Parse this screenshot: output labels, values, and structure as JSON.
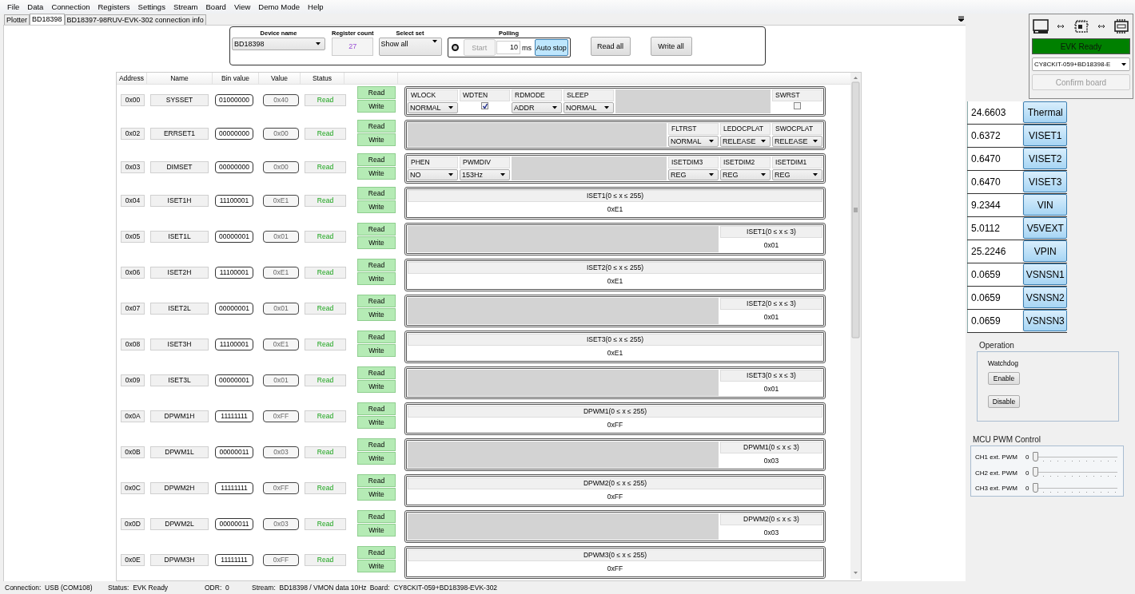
{
  "menu": [
    "File",
    "Data",
    "Connection",
    "Registers",
    "Settings",
    "Stream",
    "Board",
    "View",
    "Demo Mode",
    "Help"
  ],
  "tabs": [
    {
      "label": "Plotter",
      "selected": false
    },
    {
      "label": "BD18398",
      "selected": true
    },
    {
      "label": "BD18397-98RUV-EVK-302 connection info",
      "selected": false
    }
  ],
  "device": {
    "device_name_label": "Device name",
    "device_name": "BD18398",
    "register_count_label": "Register count",
    "register_count": "27",
    "select_set_label": "Select set",
    "select_set": "Show all"
  },
  "polling": {
    "label": "Polling",
    "start": "Start",
    "start_disabled": true,
    "interval": "10",
    "unit": "ms",
    "auto_stop": "Auto stop",
    "auto_stop_on": true
  },
  "read_all": "Read all",
  "write_all": "Write all",
  "register_table": {
    "columns": [
      "Address",
      "Name",
      "Bin value",
      "Value",
      "Status"
    ],
    "rows": [
      {
        "address": "0x00",
        "name": "SYSSET",
        "bin": "01000000",
        "value": "0x40",
        "status": "Read",
        "read": "Read",
        "write": "Write",
        "fields": [
          {
            "kind": "select",
            "label": "WLOCK",
            "value": "NORMAL"
          },
          {
            "kind": "check",
            "label": "WDTEN",
            "checked": true
          },
          {
            "kind": "select",
            "label": "RDMODE",
            "value": "ADDR"
          },
          {
            "kind": "select",
            "label": "SLEEP",
            "value": "NORMAL"
          },
          {
            "kind": "blank"
          },
          {
            "kind": "check",
            "label": "SWRST",
            "checked": false
          }
        ]
      },
      {
        "address": "0x02",
        "name": "ERRSET1",
        "bin": "00000000",
        "value": "0x00",
        "status": "Read",
        "read": "Read",
        "write": "Write",
        "fields": [
          {
            "kind": "blank"
          },
          {
            "kind": "select",
            "label": "FLTRST",
            "value": "NORMAL"
          },
          {
            "kind": "select",
            "label": "LEDOCPLAT",
            "value": "RELEASE"
          },
          {
            "kind": "select",
            "label": "SWOCPLAT",
            "value": "RELEASE"
          }
        ]
      },
      {
        "address": "0x03",
        "name": "DIMSET",
        "bin": "00000000",
        "value": "0x00",
        "status": "Read",
        "read": "Read",
        "write": "Write",
        "fields": [
          {
            "kind": "select",
            "label": "PHEN",
            "value": "NO"
          },
          {
            "kind": "select",
            "label": "PWMDIV",
            "value": "153Hz"
          },
          {
            "kind": "blank"
          },
          {
            "kind": "select",
            "label": "ISETDIM3",
            "value": "REG"
          },
          {
            "kind": "select",
            "label": "ISETDIM2",
            "value": "REG"
          },
          {
            "kind": "select",
            "label": "ISETDIM1",
            "value": "REG"
          }
        ]
      },
      {
        "address": "0x04",
        "name": "ISET1H",
        "bin": "11100001",
        "value": "0xE1",
        "status": "Read",
        "read": "Read",
        "write": "Write",
        "fields": [
          {
            "kind": "value",
            "label": "ISET1(0 ≤ x ≤ 255)",
            "value": "0xE1"
          }
        ]
      },
      {
        "address": "0x05",
        "name": "ISET1L",
        "bin": "00000001",
        "value": "0x01",
        "status": "Read",
        "read": "Read",
        "write": "Write",
        "fields": [
          {
            "kind": "blank"
          },
          {
            "kind": "value",
            "label": "ISET1(0 ≤ x ≤ 3)",
            "value": "0x01"
          }
        ]
      },
      {
        "address": "0x06",
        "name": "ISET2H",
        "bin": "11100001",
        "value": "0xE1",
        "status": "Read",
        "read": "Read",
        "write": "Write",
        "fields": [
          {
            "kind": "value",
            "label": "ISET2(0 ≤ x ≤ 255)",
            "value": "0xE1"
          }
        ]
      },
      {
        "address": "0x07",
        "name": "ISET2L",
        "bin": "00000001",
        "value": "0x01",
        "status": "Read",
        "read": "Read",
        "write": "Write",
        "fields": [
          {
            "kind": "blank"
          },
          {
            "kind": "value",
            "label": "ISET2(0 ≤ x ≤ 3)",
            "value": "0x01"
          }
        ]
      },
      {
        "address": "0x08",
        "name": "ISET3H",
        "bin": "11100001",
        "value": "0xE1",
        "status": "Read",
        "read": "Read",
        "write": "Write",
        "fields": [
          {
            "kind": "value",
            "label": "ISET3(0 ≤ x ≤ 255)",
            "value": "0xE1"
          }
        ]
      },
      {
        "address": "0x09",
        "name": "ISET3L",
        "bin": "00000001",
        "value": "0x01",
        "status": "Read",
        "read": "Read",
        "write": "Write",
        "fields": [
          {
            "kind": "blank"
          },
          {
            "kind": "value",
            "label": "ISET3(0 ≤ x ≤ 3)",
            "value": "0x01"
          }
        ]
      },
      {
        "address": "0x0A",
        "name": "DPWM1H",
        "bin": "11111111",
        "value": "0xFF",
        "status": "Read",
        "read": "Read",
        "write": "Write",
        "fields": [
          {
            "kind": "value",
            "label": "DPWM1(0 ≤ x ≤ 255)",
            "value": "0xFF"
          }
        ]
      },
      {
        "address": "0x0B",
        "name": "DPWM1L",
        "bin": "00000011",
        "value": "0x03",
        "status": "Read",
        "read": "Read",
        "write": "Write",
        "fields": [
          {
            "kind": "blank"
          },
          {
            "kind": "value",
            "label": "DPWM1(0 ≤ x ≤ 3)",
            "value": "0x03"
          }
        ]
      },
      {
        "address": "0x0C",
        "name": "DPWM2H",
        "bin": "11111111",
        "value": "0xFF",
        "status": "Read",
        "read": "Read",
        "write": "Write",
        "fields": [
          {
            "kind": "value",
            "label": "DPWM2(0 ≤ x ≤ 255)",
            "value": "0xFF"
          }
        ]
      },
      {
        "address": "0x0D",
        "name": "DPWM2L",
        "bin": "00000011",
        "value": "0x03",
        "status": "Read",
        "read": "Read",
        "write": "Write",
        "fields": [
          {
            "kind": "blank"
          },
          {
            "kind": "value",
            "label": "DPWM2(0 ≤ x ≤ 3)",
            "value": "0x03"
          }
        ]
      },
      {
        "address": "0x0E",
        "name": "DPWM3H",
        "bin": "11111111",
        "value": "0xFF",
        "status": "Read",
        "read": "Read",
        "write": "Write",
        "fields": [
          {
            "kind": "value",
            "label": "DPWM3(0 ≤ x ≤ 255)",
            "value": "0xFF"
          }
        ]
      }
    ]
  },
  "connection": {
    "status": "EVK Ready",
    "board": "CY8CKIT-059+BD18398-E",
    "confirm": "Confirm board",
    "confirm_disabled": true
  },
  "measurements": [
    {
      "value": "24.6603",
      "label": "Thermal"
    },
    {
      "value": "0.6372",
      "label": "VISET1"
    },
    {
      "value": "0.6470",
      "label": "VISET2"
    },
    {
      "value": "0.6470",
      "label": "VISET3"
    },
    {
      "value": "9.2344",
      "label": "VIN"
    },
    {
      "value": "5.0112",
      "label": "V5VEXT"
    },
    {
      "value": "25.2246",
      "label": "VPIN"
    },
    {
      "value": "0.0659",
      "label": "VSNSN1"
    },
    {
      "value": "0.0659",
      "label": "VSNSN2"
    },
    {
      "value": "0.0659",
      "label": "VSNSN3"
    }
  ],
  "operation": {
    "title": "Operation",
    "watchdog": "Watchdog",
    "buttons": [
      "Enable",
      "Disable"
    ]
  },
  "pwm": {
    "title": "MCU PWM Control",
    "channels": [
      {
        "label": "CH1 ext. PWM",
        "reading": "0",
        "level": 0
      },
      {
        "label": "CH2 ext. PWM",
        "reading": "0",
        "level": 0
      },
      {
        "label": "CH3 ext. PWM",
        "reading": "0",
        "level": 0
      }
    ]
  },
  "status_bar": [
    "Connection:  USB (COM108)",
    "Status:  EVK Ready",
    "ODR:  0",
    "Stream:  BD18398 / VMON data 10Hz",
    "Board:  CY8CKIT-059+BD18398-EVK-302"
  ]
}
